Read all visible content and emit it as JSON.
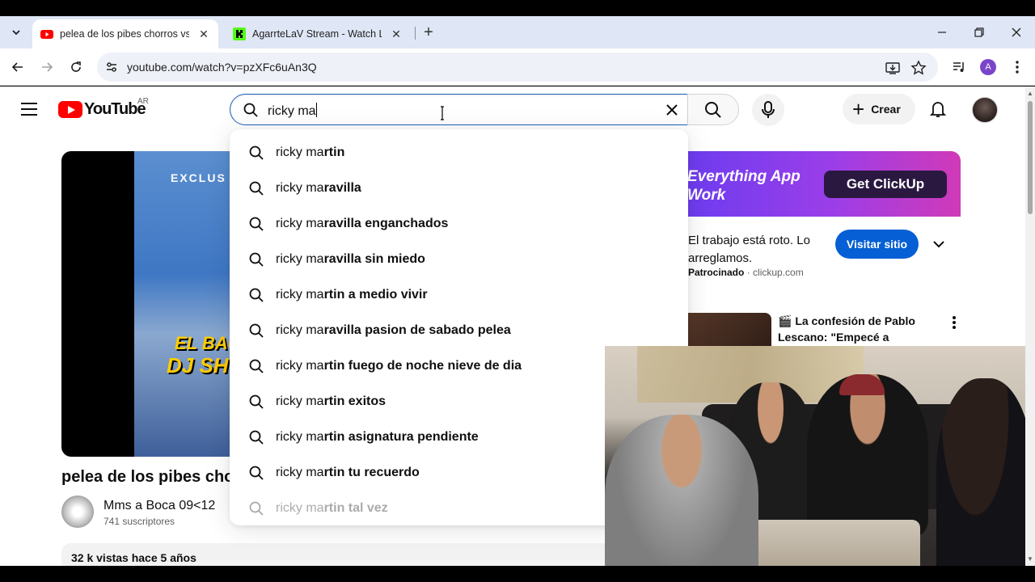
{
  "browser": {
    "tabs": [
      {
        "title": "pelea de los pibes chorros vs de",
        "favicon": "youtube-icon",
        "active": true
      },
      {
        "title": "AgarrteLaV Stream - Watch Live",
        "favicon": "kick-icon",
        "active": false
      }
    ],
    "url": "youtube.com/watch?v=pzXFc6uAn3Q",
    "profile_initial": "A"
  },
  "youtube": {
    "logo_text": "YouTube",
    "country": "AR",
    "search_query": "ricky ma",
    "create_label": "Crear",
    "suggestions": [
      {
        "typed": "ricky ma",
        "rest": "rtin"
      },
      {
        "typed": "ricky ma",
        "rest": "ravilla"
      },
      {
        "typed": "ricky ma",
        "rest": "ravilla enganchados"
      },
      {
        "typed": "ricky ma",
        "rest": "ravilla sin miedo"
      },
      {
        "typed": "ricky ma",
        "rest": "rtin a medio vivir"
      },
      {
        "typed": "ricky ma",
        "rest": "ravilla pasion de sabado pelea"
      },
      {
        "typed": "ricky ma",
        "rest": "rtin fuego de noche nieve de dia"
      },
      {
        "typed": "ricky ma",
        "rest": "rtin exitos"
      },
      {
        "typed": "ricky ma",
        "rest": "rtin asignatura pendiente"
      },
      {
        "typed": "ricky ma",
        "rest": "rtin tu recuerdo"
      },
      {
        "typed": "ricky ma",
        "rest": "rtin tal vez"
      }
    ],
    "video": {
      "overlay_top": "EXCLUS",
      "overlay_line1": "EL BAUL",
      "overlay_line2": "DJ SHORR",
      "title": "pelea de los pibes chor",
      "channel_name": "Mms a Boca 09<12",
      "subscribers": "741 suscriptores",
      "views_line": "32 k vistas  hace 5 años"
    },
    "ad": {
      "headline_line1": "Everything App",
      "headline_line2": "Work",
      "cta_banner": "Get ClickUp",
      "text": "El trabajo está roto. Lo arreglamos.",
      "sponsored_label": "Patrocinado",
      "domain": "· clickup.com",
      "visit_label": "Visitar sitio"
    },
    "recommended": {
      "title": "La confesión de Pablo Lescano: \"Empecé a drogarme..."
    }
  },
  "colors": {
    "youtube_red": "#ff0000",
    "link_blue": "#065fd4",
    "search_border": "#1c62b9"
  }
}
